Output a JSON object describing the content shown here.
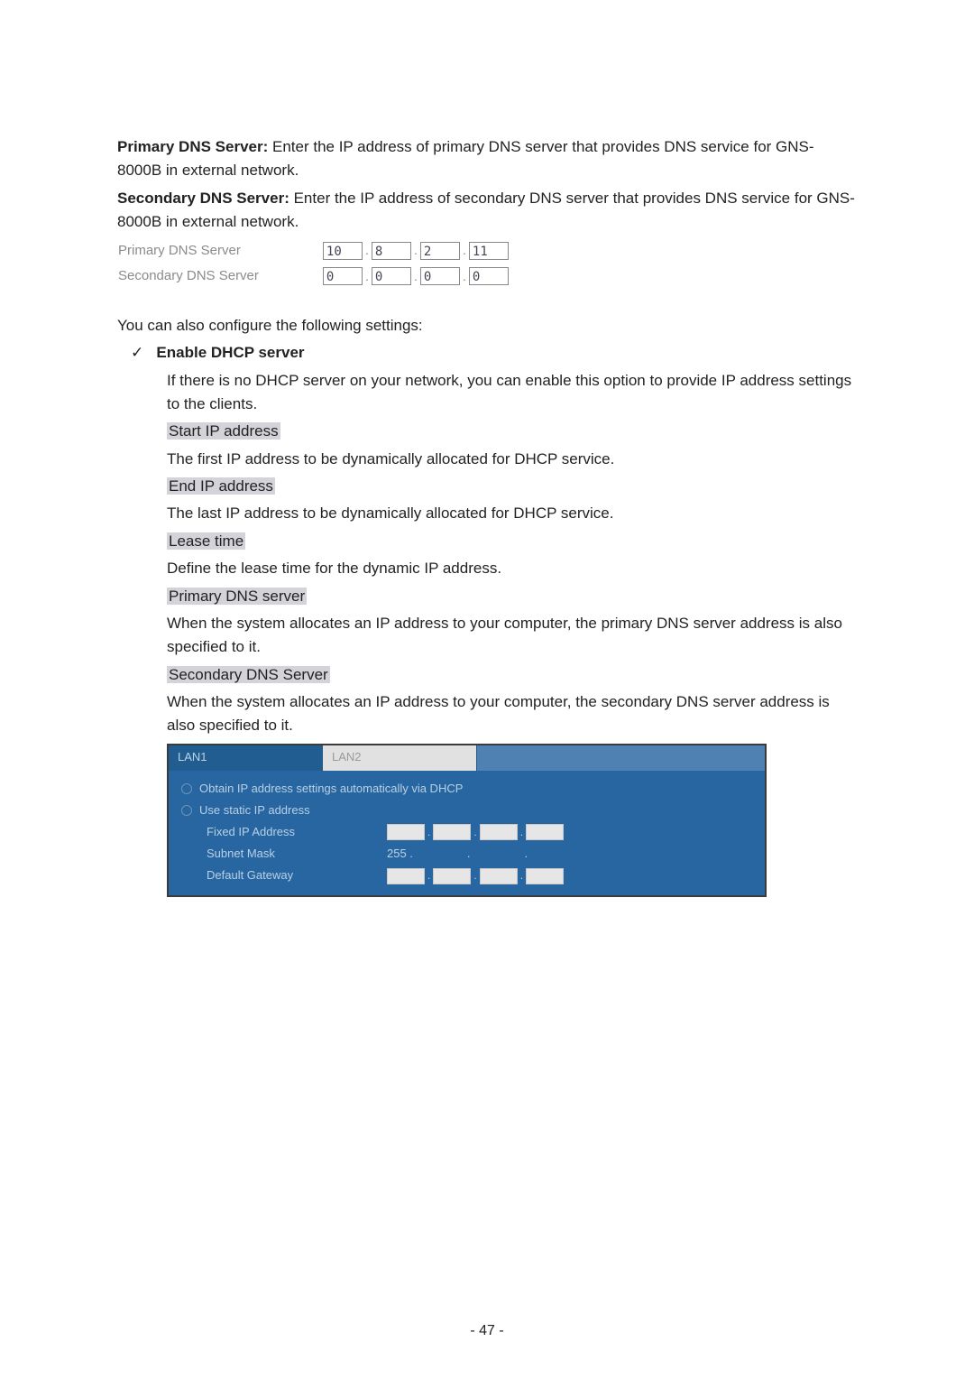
{
  "intro": {
    "primary_label": "Primary DNS Server:",
    "primary_text": " Enter the IP address of primary DNS server that provides DNS service for GNS-8000B in external network.",
    "secondary_label": "Secondary DNS Server:",
    "secondary_text": " Enter the IP address of secondary DNS server that provides DNS service for GNS-8000B in external network."
  },
  "dns_rows": {
    "primary": {
      "label": "Primary DNS Server",
      "o1": "10",
      "o2": "8",
      "o3": "2",
      "o4": "11"
    },
    "secondary": {
      "label": "Secondary DNS Server",
      "o1": "0",
      "o2": "0",
      "o3": "0",
      "o4": "0"
    }
  },
  "section2": {
    "lead": "You can also configure the following settings:",
    "checkmark": "✓",
    "enable": "Enable DHCP server",
    "enable_desc1": "If there is no DHCP server on your network, you can enable this option to provide IP address settings to the clients.",
    "start_h": "Start IP address",
    "start_d": "The first IP address to be dynamically allocated for DHCP service.",
    "end_h": "End IP address",
    "end_d": "The last IP address to be dynamically allocated for DHCP service.",
    "lease_h": "Lease time",
    "lease_d": "Define the lease time for the dynamic IP address.",
    "pdns_h": "Primary DNS server",
    "pdns_d": "When the system allocates an IP address to your computer, the primary DNS server address is also specified to it.",
    "sdns_h": "Secondary DNS Server",
    "sdns_d": "When the system allocates an IP address to your computer, the secondary DNS server address is also specified to it."
  },
  "lan_panel": {
    "tab1": "LAN1",
    "tab2": "LAN2",
    "radio1": "Obtain IP address settings automatically via DHCP",
    "radio2": "Use static IP address",
    "fixed_ip": "Fixed IP Address",
    "subnet": "Subnet Mask",
    "subnet_val": "255 .",
    "gateway": "Default Gateway"
  },
  "page_num": "- 47 -"
}
